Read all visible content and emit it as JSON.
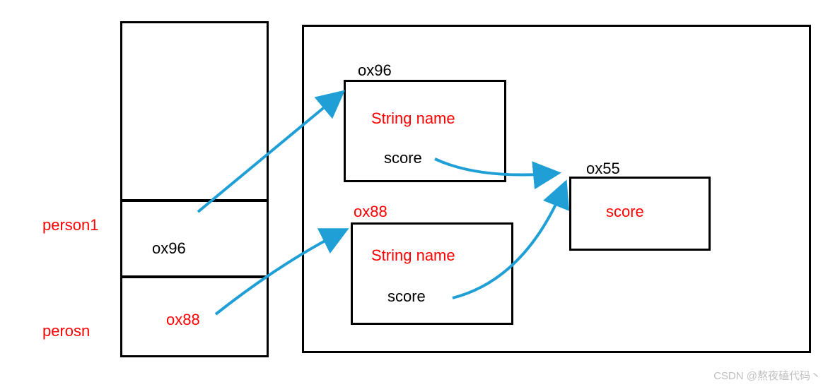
{
  "stack": {
    "person1_label": "person1",
    "person1_value": "ox96",
    "person_label": "perosn",
    "person_value": "ox88"
  },
  "heap": {
    "obj1": {
      "addr": "ox96",
      "name_field": "String name",
      "score_field": "score"
    },
    "obj2": {
      "addr": "ox88",
      "name_field": "String name",
      "score_field": "score"
    },
    "score_obj": {
      "addr": "ox55",
      "content": "score"
    }
  },
  "watermark": "CSDN @熬夜磕代码丶"
}
